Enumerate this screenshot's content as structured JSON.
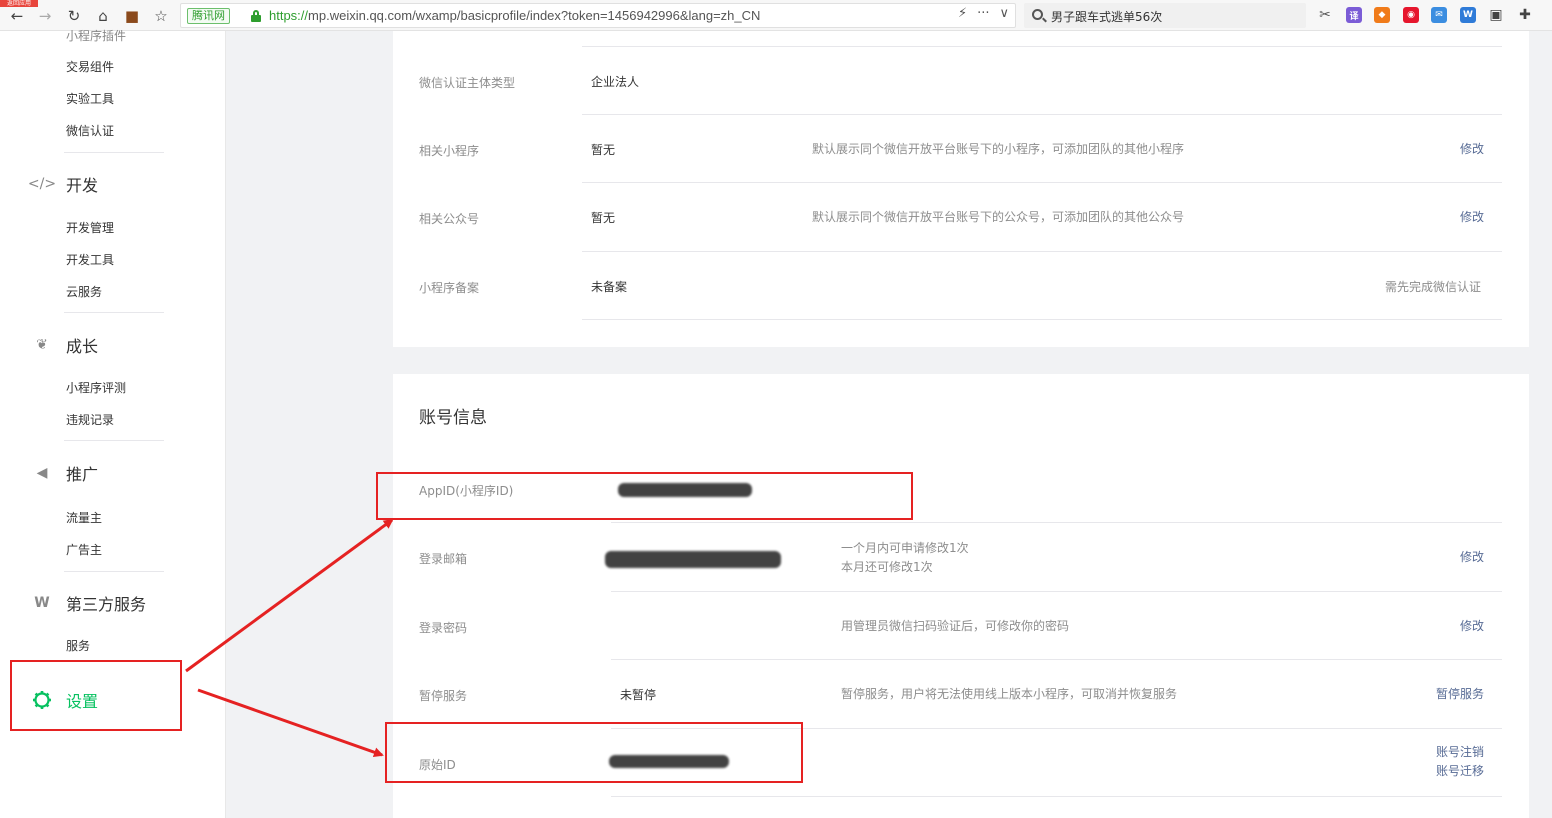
{
  "browser": {
    "corner_badge": "返回应用",
    "cert_label": "腾讯网",
    "url_scheme": "https://",
    "url_rest": "mp.weixin.qq.com/wxamp/basicprofile/index?token=1456942996&lang=zh_CN",
    "url_more": "···",
    "url_dropdown": "∨",
    "search_text": "男子跟车式逃单56次",
    "extensions": [
      {
        "name": "cut-icon",
        "color": "#555555",
        "glyph": "✂"
      },
      {
        "name": "translate-icon",
        "color": "#7b5cd6",
        "glyph": "译"
      },
      {
        "name": "fox-icon",
        "color": "#f07b1a",
        "glyph": "◆"
      },
      {
        "name": "weibo-icon",
        "color": "#e6162d",
        "glyph": "◉"
      },
      {
        "name": "mail-icon",
        "color": "#3b8de0",
        "glyph": "✉"
      },
      {
        "name": "w-icon",
        "color": "#2f7bd8",
        "glyph": "W"
      },
      {
        "name": "window-icon",
        "color": "#444444",
        "glyph": "▣"
      },
      {
        "name": "puzzle-icon",
        "color": "#444444",
        "glyph": "✚"
      }
    ]
  },
  "sidebar": {
    "top_items": [
      "小程序插件",
      "交易组件",
      "实验工具",
      "微信认证"
    ],
    "groups": [
      {
        "label": "开发",
        "icon": "code-icon",
        "items": [
          "开发管理",
          "开发工具",
          "云服务"
        ]
      },
      {
        "label": "成长",
        "icon": "sprout-icon",
        "items": [
          "小程序评测",
          "违规记录"
        ]
      },
      {
        "label": "推广",
        "icon": "megaphone-icon",
        "items": [
          "流量主",
          "广告主"
        ]
      },
      {
        "label": "第三方服务",
        "icon": "third-party-icon",
        "items": [
          "服务"
        ]
      }
    ],
    "active": {
      "label": "设置",
      "icon": "gear-icon"
    },
    "colors": {
      "active": "#07c160"
    }
  },
  "basic_info": {
    "rows": [
      {
        "label": "微信认证主体类型",
        "value": "企业法人",
        "desc": "",
        "action": ""
      },
      {
        "label": "相关小程序",
        "value": "暂无",
        "desc": "默认展示同个微信开放平台账号下的小程序，可添加团队的其他小程序",
        "action": "修改"
      },
      {
        "label": "相关公众号",
        "value": "暂无",
        "desc": "默认展示同个微信开放平台账号下的公众号，可添加团队的其他公众号",
        "action": "修改"
      },
      {
        "label": "小程序备案",
        "value": "未备案",
        "desc": "",
        "action_gray": "需先完成微信认证"
      }
    ]
  },
  "account_info": {
    "title": "账号信息",
    "appid_label": "AppID(小程序ID)",
    "email_label": "登录邮箱",
    "email_desc_1": "一个月内可申请修改1次",
    "email_desc_2": "本月还可修改1次",
    "email_action": "修改",
    "password_label": "登录密码",
    "password_desc": "用管理员微信扫码验证后，可修改你的密码",
    "password_action": "修改",
    "pause_label": "暂停服务",
    "pause_value": "未暂停",
    "pause_desc": "暂停服务，用户将无法使用线上版本小程序，可取消并恢复服务",
    "pause_action": "暂停服务",
    "original_id_label": "原始ID",
    "cancel_action": "账号注销",
    "migrate_action": "账号迁移"
  },
  "colors": {
    "annotation_red": "#e52222",
    "link": "#576b95"
  }
}
